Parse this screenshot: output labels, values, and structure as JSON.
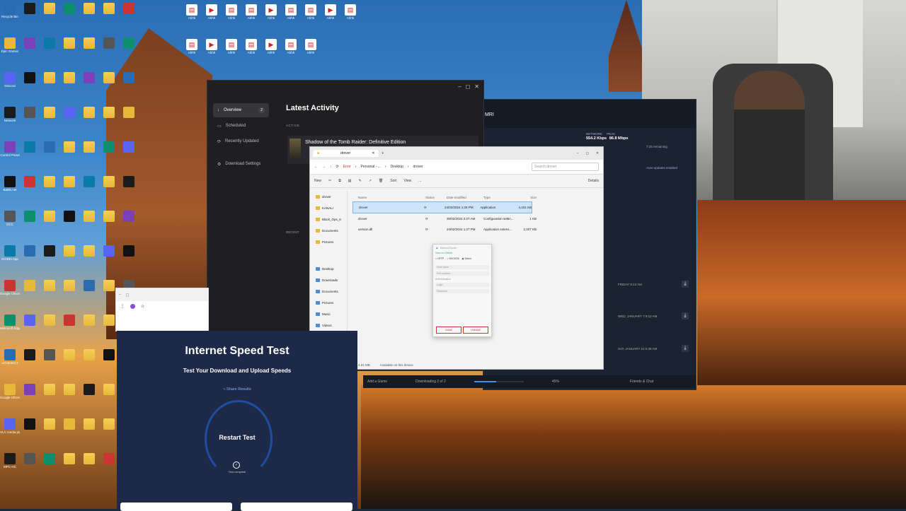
{
  "desktop": {
    "icons_col1": [
      "Recycle Bin",
      "Steam",
      "Epic Games",
      "This PC",
      "Discord",
      "TikTok LIVE Studio",
      "Network",
      "Muck",
      "Control Panel",
      "Wallpaper Engine",
      "Battle.net",
      "Data Forza",
      "GCC",
      "Apex Legends",
      "NVIDIA App",
      "One-armed robber",
      "Google Chrome",
      "EA",
      "Microsoft Edge",
      "EA SPORTS FC 25",
      "LConnect 3",
      "KANALI",
      "Google Chrome",
      "Firefox",
      "VLC media player",
      "Epic Games Launcher",
      "MPC-HC",
      "Brave"
    ],
    "icons_top_files": [
      "Ahhh",
      "Ahhh",
      "Ahhh",
      "Ahhh",
      "Ahhh",
      "Ahhh",
      "Ahhh",
      "Ahhh",
      "Ahhh",
      "Ahhh",
      "Ahhh",
      "Ahhh",
      "Ahhh",
      "Ahhh",
      "Ahhh",
      "Ahhh"
    ]
  },
  "launcher": {
    "window_controls": [
      "–",
      "◻",
      "✕"
    ],
    "nav": [
      {
        "label": "Overview",
        "badge": "2",
        "active": true
      },
      {
        "label": "Scheduled",
        "badge": "",
        "active": false
      },
      {
        "label": "Recently Updated",
        "badge": "",
        "active": false
      },
      {
        "label": "Download Settings",
        "badge": "",
        "active": false
      }
    ],
    "title": "Latest Activity",
    "active_label": "ACTIVE",
    "game_name": "Shadow of the Tomb Raider: Definitive Edition",
    "recent_label": "RECENT"
  },
  "launcher2": {
    "title_fragment": "MRI",
    "network_label": "NETWORK",
    "network_value": "554.2 Kbps",
    "peak_label": "PEAK",
    "peak_value": "86.8 Mbps",
    "remaining": "7:25 remaining",
    "auto_updates": "Auto-updates enabled",
    "downloads": [
      {
        "when": "FRIDAY 6:13 AM"
      },
      {
        "when": "WED, JANUARY 7 9:12 AM"
      },
      {
        "when": "SAT, JANUARY 10 5:38 AM"
      }
    ],
    "bottom": {
      "add_game": "Add a Game",
      "downloading": "Downloading 2 of 2",
      "percent": "45%",
      "progress": 0.45,
      "friends": "Friends & Chat"
    }
  },
  "explorer": {
    "tab": "drover",
    "crumbs": [
      "Error",
      "Personal - ...",
      "Desktop",
      "drover"
    ],
    "search_placeholder": "Search drover",
    "toolbar": [
      "New",
      "Sort",
      "View",
      "..."
    ],
    "details": "Details",
    "sidebar": [
      "drover",
      "KANALI",
      "Black_Ops_6",
      "Documents",
      "Pictures",
      "Desktop",
      "Downloads",
      "Documents",
      "Pictures",
      "Music",
      "Videos",
      "DCIM",
      "This PC"
    ],
    "headers": {
      "name": "Name",
      "status": "Status",
      "date": "Date modified",
      "type": "Type",
      "size": "Size"
    },
    "rows": [
      {
        "name": "drover",
        "status": "⟳",
        "date": "24/02/2024 1:26 PM",
        "type": "Application",
        "size": "4,431 KB",
        "selected": true
      },
      {
        "name": "drover",
        "status": "⟳",
        "date": "30/02/2024 2:27 AM",
        "type": "Configuration settin...",
        "size": "1 KB",
        "selected": false
      },
      {
        "name": "version.dll",
        "status": "⟳",
        "date": "24/02/2024 1:27 PM",
        "type": "Application extens...",
        "size": "2,207 KB",
        "selected": false
      }
    ],
    "status_bar": {
      "items": "3 items",
      "selected": "1 item selected  4.31 MB",
      "avail": "Available on this device"
    }
  },
  "dialog": {
    "title": "Discord Drover",
    "subtitle": "View on GitHub",
    "options": [
      "HTTP",
      "SOCKS5",
      "Direct"
    ],
    "fields": [
      "Host name",
      "Port number",
      "Authentication",
      "Login",
      "Password"
    ],
    "install": "Install",
    "uninstall": "Uninstall"
  },
  "speedtest": {
    "title": "Internet Speed Test",
    "subtitle": "Test Your Download and Upload Speeds",
    "share": "Share Results",
    "button": "Restart Test",
    "done": "Test complete"
  },
  "colors": {
    "accent": "#3b8fe6",
    "speedtest_bg": "#1e2948",
    "launcher_bg": "#1f1f22"
  }
}
